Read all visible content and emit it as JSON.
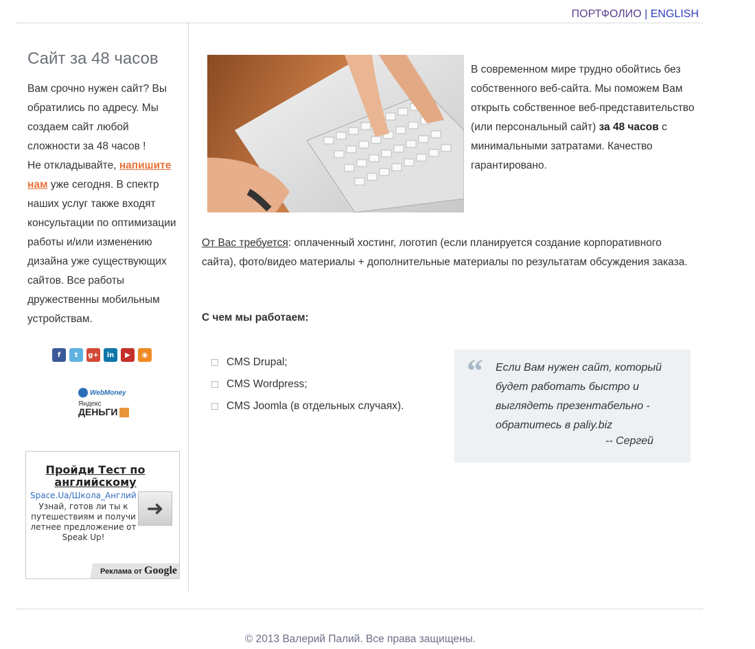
{
  "nav": {
    "portfolio": "ПОРТФОЛИО",
    "separator": "|",
    "english": "ENGLISH"
  },
  "sidebar": {
    "title": "Сайт за 48 часов",
    "text_1": "Вам срочно нужен сайт? Вы обратились по адресу. Мы создаем сайт любой сложности за 48 часов !",
    "text_2": "Не откладывайте, ",
    "link": "напишите нам",
    "text_3": " уже сегодня. В спектр наших услуг также входят консультации по оптимизации работы и/или изменению дизайна уже существующих сайтов. Все работы дружественны мобильным устройствам.",
    "social_icons": [
      {
        "name": "facebook-icon",
        "glyph": "f",
        "color": "#3b5998"
      },
      {
        "name": "twitter-icon",
        "glyph": "t",
        "color": "#5fb2e0"
      },
      {
        "name": "google-plus-icon",
        "glyph": "g+",
        "color": "#d34836"
      },
      {
        "name": "linkedin-icon",
        "glyph": "in",
        "color": "#0e76a8"
      },
      {
        "name": "youtube-icon",
        "glyph": "▶",
        "color": "#c4302b"
      },
      {
        "name": "rss-icon",
        "glyph": "◉",
        "color": "#f08a24"
      }
    ],
    "payments": {
      "webmoney": "WebMoney",
      "yandex_1": "Яндекс",
      "yandex_2": "ДЕНЬГИ"
    },
    "ad": {
      "title": "Пройди Тест по английскому",
      "url": "Space.Ua/Школа_Английского",
      "description": "Узнай, готов ли ты к путешествиям и получи летнее предложение от Speak Up!",
      "footer_prefix": "Реклама от",
      "footer_brand": "Google"
    }
  },
  "main": {
    "intro_1": "В современном мире трудно обойтись без собственного веб-сайта. Мы поможем Вам открыть собственное веб-представительство (или персональный сайт) ",
    "intro_bold": "за 48 часов",
    "intro_2": " с минимальными затратами. Качество гарантировано.",
    "req_label": "От Вас требуется",
    "req_text": ": оплаченный хостинг, логотип (если планируется создание корпоративного сайта), фото/видео материалы + дополнительные материалы по результатам обсуждения заказа.",
    "works_title": "С чем мы работаем:",
    "cms": [
      "CMS Drupal;",
      "CMS Wordpress;",
      "CMS Joomla (в отдельных случаях)."
    ],
    "quote_text": "Если Вам нужен сайт, который будет работать быстро и выглядеть презентабельно - обратитесь в paliy.biz",
    "quote_author": "-- Сергей"
  },
  "footer": "© 2013 Валерий Палий. Все права защищены."
}
